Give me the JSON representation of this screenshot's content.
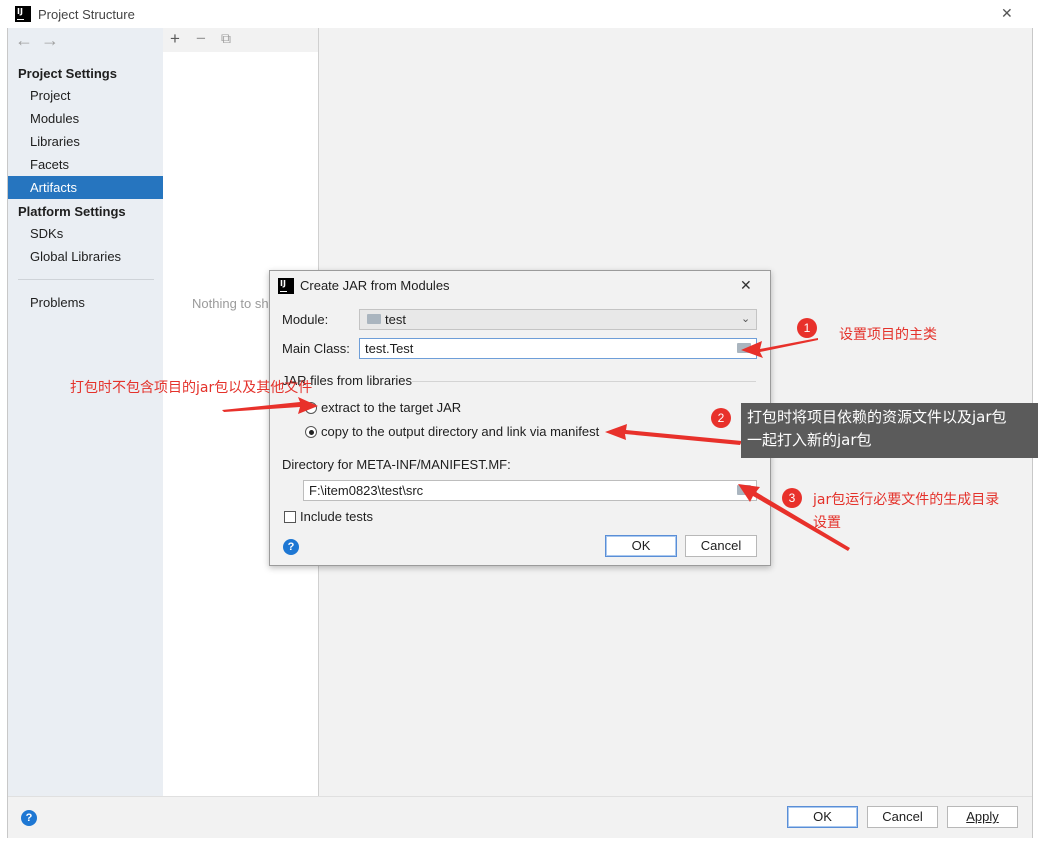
{
  "window": {
    "title": "Project Structure",
    "close_glyph": "✕"
  },
  "nav": {
    "back": "←",
    "forward": "→"
  },
  "sidebar": {
    "project_settings_header": "Project Settings",
    "project_items": [
      "Project",
      "Modules",
      "Libraries",
      "Facets",
      "Artifacts"
    ],
    "selected": "Artifacts",
    "platform_settings_header": "Platform Settings",
    "platform_items": [
      "SDKs",
      "Global Libraries"
    ],
    "problems": "Problems"
  },
  "middle": {
    "add": "+",
    "remove": "−",
    "copy": "⧉",
    "empty_text": "Nothing to sh"
  },
  "bottom": {
    "ok": "OK",
    "cancel": "Cancel",
    "apply": "Apply",
    "help": "?"
  },
  "dialog": {
    "title": "Create JAR from Modules",
    "close_glyph": "✕",
    "module_label": "Module:",
    "module_value": "test",
    "main_class_label": "Main Class:",
    "main_class_value": "test.Test",
    "jar_files_section": "JAR files from libraries",
    "radio_extract": "extract to the target JAR",
    "radio_copy": "copy to the output directory and link via manifest",
    "radio_selected": "copy",
    "manifest_dir_label": "Directory for META-INF/MANIFEST.MF:",
    "manifest_dir_value": "F:\\item0823\\test\\src",
    "include_tests": "Include tests",
    "include_tests_checked": false,
    "ok": "OK",
    "cancel": "Cancel",
    "help": "?"
  },
  "annotations": {
    "badge1": "1",
    "note1": "设置项目的主类",
    "left_note": "打包时不包含项目的jar包以及其他文件",
    "badge2": "2",
    "note2_line1": "打包时将项目依赖的资源文件以及jar包",
    "note2_line2": "一起打入新的jar包",
    "badge3": "3",
    "note3_line1": "jar包运行必要文件的生成目录",
    "note3_line2": "设置",
    "accent_color": "#e8312b"
  },
  "icons": [
    "intellij-logo-icon",
    "close-icon",
    "back-arrow-icon",
    "forward-arrow-icon",
    "add-icon",
    "remove-icon",
    "copy-icon",
    "folder-icon",
    "chevron-down-icon",
    "browse-folder-icon",
    "help-icon"
  ]
}
